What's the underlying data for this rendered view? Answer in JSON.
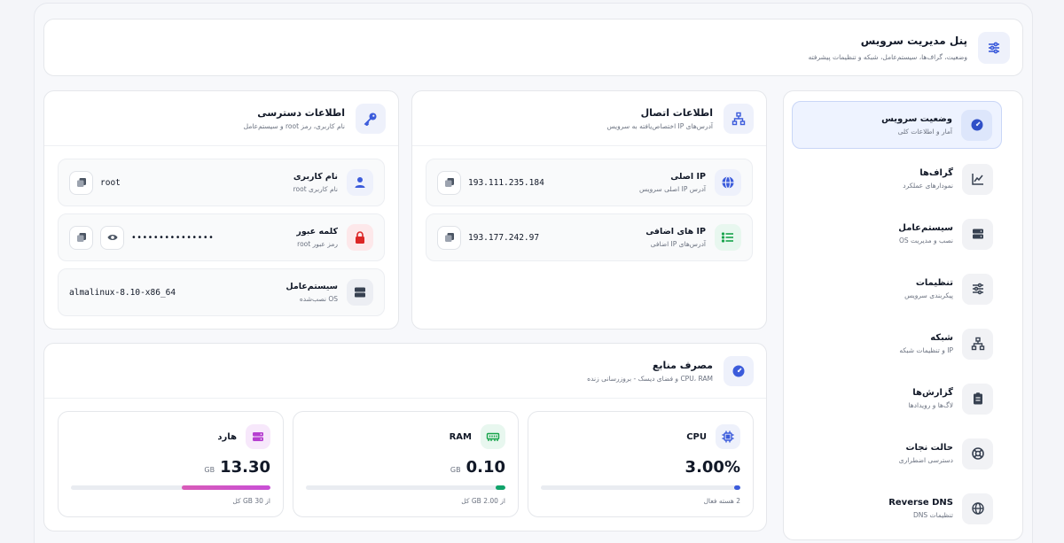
{
  "header": {
    "title": "پنل مدیریت سرویس",
    "subtitle": "وضعیت، گراف‌ها، سیستم‌عامل، شبکه و تنظیمات پیشرفته"
  },
  "sidebar": {
    "items": [
      {
        "title": "وضعیت سرویس",
        "subtitle": "آمار و اطلاعات کلی",
        "icon": "gauge-icon",
        "active": true
      },
      {
        "title": "گراف‌ها",
        "subtitle": "نمودارهای عملکرد",
        "icon": "chart-line-icon",
        "active": false
      },
      {
        "title": "سیستم‌عامل",
        "subtitle": "نصب و مدیریت OS",
        "icon": "server-icon",
        "active": false
      },
      {
        "title": "تنظیمات",
        "subtitle": "پیکربندی سرویس",
        "icon": "sliders-icon",
        "active": false
      },
      {
        "title": "شبکه",
        "subtitle": "IP و تنظیمات شبکه",
        "icon": "network-icon",
        "active": false
      },
      {
        "title": "گزارش‌ها",
        "subtitle": "لاگ‌ها و رویدادها",
        "icon": "clipboard-icon",
        "active": false
      },
      {
        "title": "حالت نجات",
        "subtitle": "دسترسی اضطراری",
        "icon": "lifebuoy-icon",
        "active": false
      },
      {
        "title": "Reverse DNS",
        "subtitle": "تنظیمات DNS",
        "icon": "globe-icon",
        "active": false
      }
    ]
  },
  "connection": {
    "title": "اطلاعات اتصال",
    "subtitle": "آدرس‌های IP اختصاص‌یافته به سرویس",
    "main_ip": {
      "label": "IP اصلی",
      "sub": "آدرس IP اصلی سرویس",
      "value": "193.111.235.184"
    },
    "extra_ip": {
      "label": "IP های اضافی",
      "sub": "آدرس‌های IP اضافی",
      "value": "193.177.242.97"
    }
  },
  "access": {
    "title": "اطلاعات دسترسی",
    "subtitle": "نام کاربری، رمز root و سیستم‌عامل",
    "username": {
      "label": "نام کاربری",
      "sub": "نام کاربری root",
      "value": "root"
    },
    "password": {
      "label": "کلمه عبور",
      "sub": "رمز عبور root",
      "value": "•••••••••••••••"
    },
    "os": {
      "label": "سیستم‌عامل",
      "sub": "OS نصب‌شده",
      "value": "almalinux-8.10-x86_64"
    }
  },
  "resources": {
    "title": "مصرف منابع",
    "subtitle": "CPU، RAM و فضای دیسک - بروزرسانی زنده",
    "cpu": {
      "label": "CPU",
      "value": "3.00%",
      "unit": "",
      "percent": 3,
      "footer": "2 هسته فعال",
      "color": "#3b5bdb"
    },
    "ram": {
      "label": "RAM",
      "value": "0.10",
      "unit": "GB",
      "percent": 5,
      "footer": "از 2.00 GB کل",
      "color": "#10a36a"
    },
    "disk": {
      "label": "هارد",
      "value": "13.30",
      "unit": "GB",
      "percent": 44.3,
      "footer": "از 30 GB کل",
      "color": "#c94fd6"
    }
  }
}
